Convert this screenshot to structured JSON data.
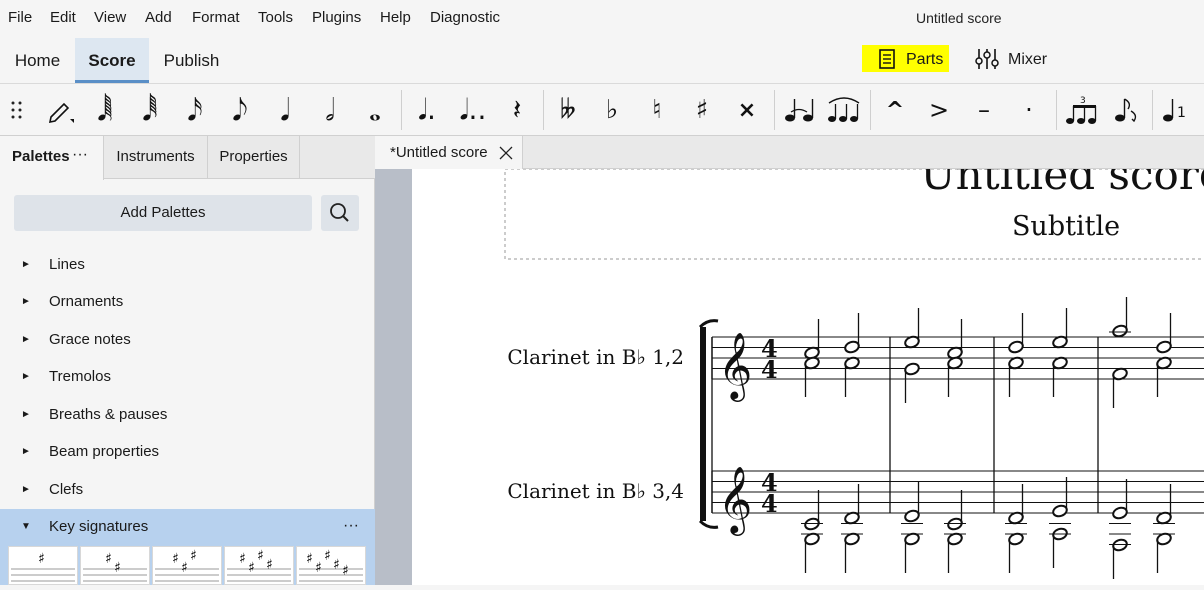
{
  "menu": [
    "File",
    "Edit",
    "View",
    "Add",
    "Format",
    "Tools",
    "Plugins",
    "Help",
    "Diagnostic"
  ],
  "window_title": "Untitled score",
  "tabs": {
    "home": "Home",
    "score": "Score",
    "publish": "Publish"
  },
  "parts_label": "Parts",
  "mixer_label": "Mixer",
  "panel_tabs": {
    "palettes": "Palettes",
    "palettes_more": "···",
    "instruments": "Instruments",
    "properties": "Properties"
  },
  "add_palettes_label": "Add Palettes",
  "palettes": [
    {
      "name": "Lines",
      "expanded": false
    },
    {
      "name": "Ornaments",
      "expanded": false
    },
    {
      "name": "Grace notes",
      "expanded": false
    },
    {
      "name": "Tremolos",
      "expanded": false
    },
    {
      "name": "Breaths & pauses",
      "expanded": false
    },
    {
      "name": "Beam properties",
      "expanded": false
    },
    {
      "name": "Clefs",
      "expanded": false
    },
    {
      "name": "Key signatures",
      "expanded": true
    }
  ],
  "key_sig_more": "···",
  "score_tab_label": "*Untitled score",
  "score": {
    "title": "Untitled score",
    "subtitle": "Subtitle",
    "staff1_name": "Clarinet in B♭ 1,2",
    "staff2_name": "Clarinet in B♭ 3,4",
    "time_signature": "4/4"
  },
  "key_signatures_sharps": [
    1,
    2,
    3,
    4,
    5
  ],
  "colors": {
    "accent": "#5a8fc7",
    "highlight": "#ffff00",
    "selected_palette": "#b7d1ee"
  }
}
